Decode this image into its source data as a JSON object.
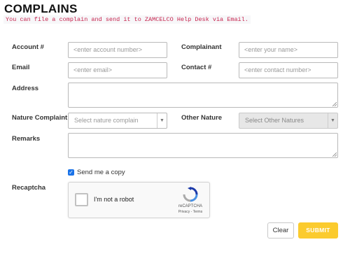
{
  "page": {
    "title": "COMPLAINS",
    "subtitle": "You can file a complain and send it to ZAMCELCO Help Desk via Email."
  },
  "form": {
    "account_label": "Account #",
    "account_placeholder": "<enter account number>",
    "complainant_label": "Complainant",
    "complainant_placeholder": "<enter your name>",
    "email_label": "Email",
    "email_placeholder": "<enter email>",
    "contact_label": "Contact #",
    "contact_placeholder": "<enter contact number>",
    "address_label": "Address",
    "nature_label": "Nature Complaint",
    "nature_value": "Select nature complain",
    "other_label": "Other Nature",
    "other_value": "Select Other Natures",
    "remarks_label": "Remarks",
    "send_copy_label": "Send me a copy",
    "send_copy_checked": true,
    "recaptcha_label": "Recaptcha"
  },
  "recaptcha": {
    "checkbox_label": "I'm not a robot",
    "brand": "reCAPTCHA",
    "privacy": "Privacy",
    "terms": "Terms",
    "separator": "-"
  },
  "buttons": {
    "clear": "Clear",
    "submit": "SUBMIT"
  },
  "colors": {
    "accent": "#fbcb2e",
    "subtitle_text": "#c7254e",
    "checkbox": "#1a73e8"
  }
}
